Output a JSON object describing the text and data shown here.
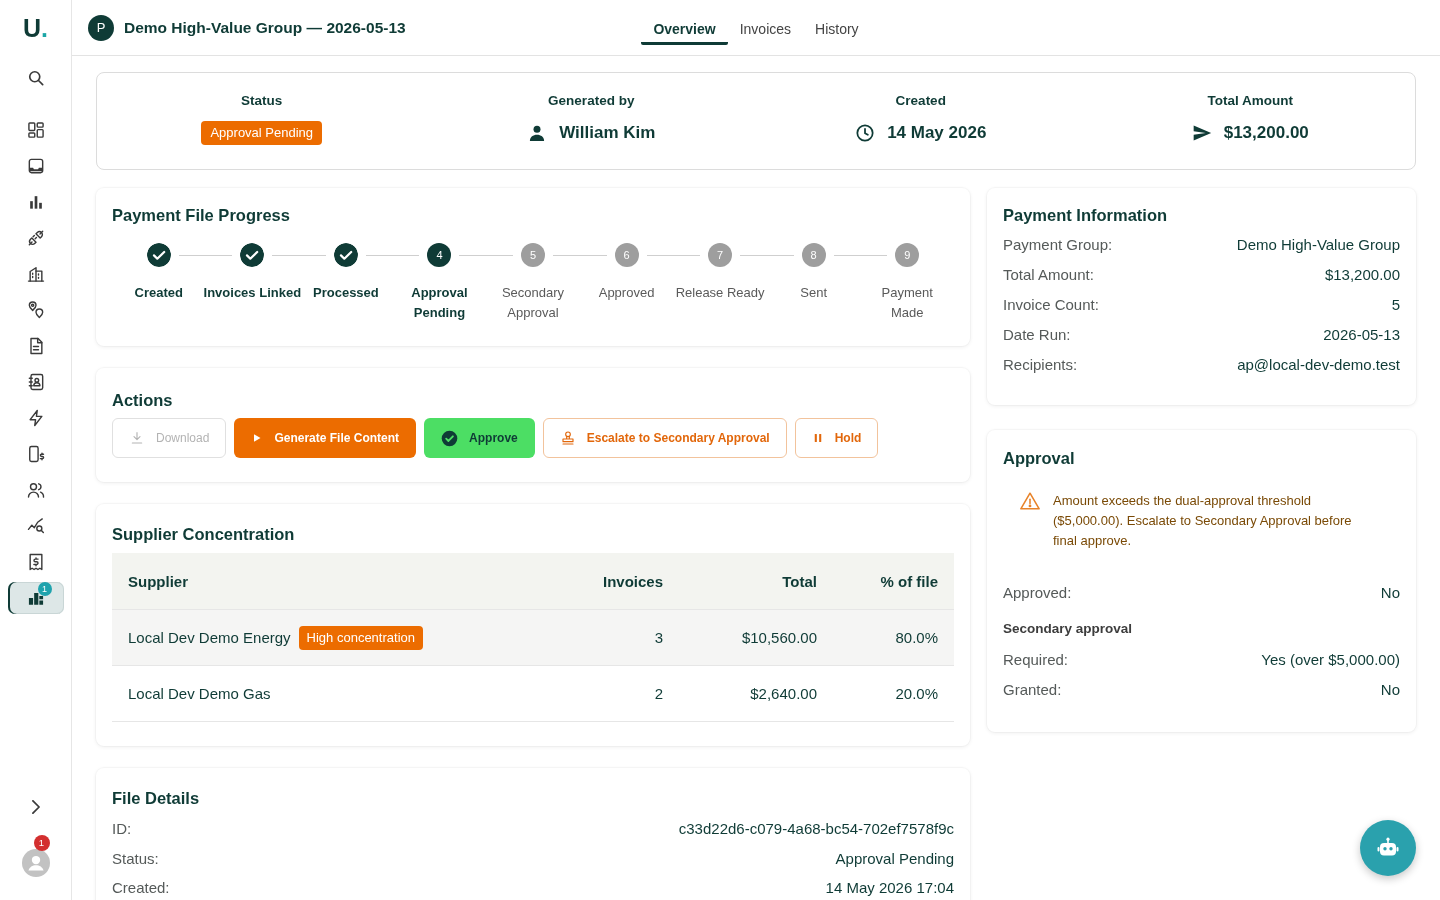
{
  "sidebar": {
    "logo": "U.",
    "nav": [
      {
        "selected": false
      },
      {
        "selected": false
      },
      {
        "selected": false
      },
      {
        "selected": false
      },
      {
        "selected": false
      },
      {
        "selected": false
      },
      {
        "selected": false
      },
      {
        "selected": false
      },
      {
        "selected": false
      },
      {
        "selected": false
      },
      {
        "selected": false
      },
      {
        "selected": false
      },
      {
        "selected": false
      },
      {
        "selected": true,
        "badge": "1"
      }
    ],
    "user_badge": "1"
  },
  "header": {
    "avatar": "P",
    "title": "Demo High-Value Group — 2026-05-13",
    "tabs": [
      {
        "label": "Overview",
        "selected": true
      },
      {
        "label": "Invoices",
        "selected": false
      },
      {
        "label": "History",
        "selected": false
      }
    ]
  },
  "summary": [
    {
      "label": "Status",
      "kind": "badge",
      "value": "Approval Pending"
    },
    {
      "label": "Generated by",
      "kind": "person",
      "value": "William Kim"
    },
    {
      "label": "Created",
      "kind": "date",
      "value": "14 May 2026"
    },
    {
      "label": "Total Amount",
      "kind": "amount",
      "value": "$13,200.00"
    }
  ],
  "progress": {
    "title": "Payment File Progress",
    "steps": [
      {
        "label": "Created",
        "completed": true,
        "active": false
      },
      {
        "label": "Invoices Linked",
        "completed": true,
        "active": false
      },
      {
        "label": "Processed",
        "completed": true,
        "active": false
      },
      {
        "label": "Approval Pending",
        "number": "4",
        "completed": false,
        "active": true
      },
      {
        "label": "Secondary Approval",
        "number": "5",
        "completed": false,
        "active": false
      },
      {
        "label": "Approved",
        "number": "6",
        "completed": false,
        "active": false
      },
      {
        "label": "Release Ready",
        "number": "7",
        "completed": false,
        "active": false
      },
      {
        "label": "Sent",
        "number": "8",
        "completed": false,
        "active": false
      },
      {
        "label": "Payment Made",
        "number": "9",
        "completed": false,
        "active": false
      }
    ]
  },
  "actions": {
    "title": "Actions",
    "buttons": [
      {
        "label": "Download",
        "kind": "download",
        "disabled": true
      },
      {
        "label": "Generate File Content",
        "kind": "generate",
        "disabled": false
      },
      {
        "label": "Approve",
        "kind": "approve",
        "disabled": false
      },
      {
        "label": "Escalate to Secondary Approval",
        "kind": "escalate",
        "disabled": false
      },
      {
        "label": "Hold",
        "kind": "hold",
        "disabled": false
      }
    ]
  },
  "supplier_concentration": {
    "title": "Supplier Concentration",
    "columns": [
      "Supplier",
      "Invoices",
      "Total",
      "% of file"
    ],
    "rows": [
      {
        "supplier": "Local Dev Demo Energy",
        "tag": "High concentration",
        "invoices": "3",
        "total": "$10,560.00",
        "share": "80.0%"
      },
      {
        "supplier": "Local Dev Demo Gas",
        "invoices": "2",
        "total": "$2,640.00",
        "share": "20.0%"
      }
    ]
  },
  "file_details": {
    "title": "File Details",
    "rows": [
      {
        "label": "ID:",
        "value": "c33d22d6-c079-4a68-bc54-702ef7578f9c"
      },
      {
        "label": "Status:",
        "value": "Approval Pending"
      },
      {
        "label": "Created:",
        "value": "14 May 2026 17:04"
      }
    ]
  },
  "payment_information": {
    "title": "Payment Information",
    "rows": [
      {
        "label": "Payment Group:",
        "value": "Demo High-Value Group"
      },
      {
        "label": "Total Amount:",
        "value": "$13,200.00"
      },
      {
        "label": "Invoice Count:",
        "value": "5"
      },
      {
        "label": "Date Run:",
        "value": "2026-05-13"
      },
      {
        "label": "Recipients:",
        "value": "ap@local-dev-demo.test"
      }
    ]
  },
  "approval": {
    "title": "Approval",
    "warning": "Amount exceeds the dual-approval threshold ($5,000.00). Escalate to Secondary Approval before final approve.",
    "rows": [
      {
        "label": "Approved:",
        "value": "No"
      }
    ],
    "secondary": {
      "title": "Secondary approval",
      "rows": [
        {
          "label": "Required:",
          "value": "Yes (over $5,000.00)"
        },
        {
          "label": "Granted:",
          "value": "No"
        }
      ]
    }
  }
}
